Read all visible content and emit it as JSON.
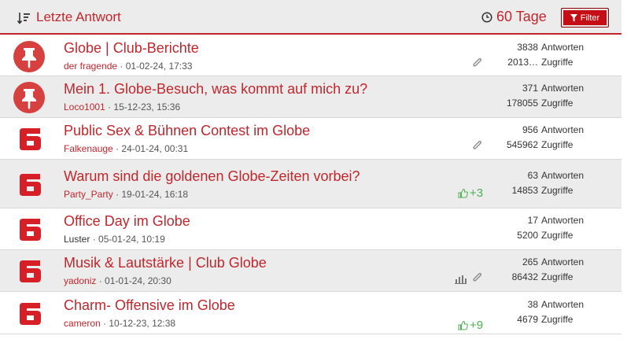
{
  "header": {
    "sort_label": "Letzte Antwort",
    "days_label": "60 Tage",
    "filter_label": "Filter"
  },
  "threads": [
    {
      "title": "Globe | Club-Berichte",
      "author": "der fragende",
      "date": "01-02-24, 17:33",
      "replies": "3838",
      "replies_label": "Antworten",
      "views": "2013…",
      "views_label": "Zugriffe",
      "avatar": "pin-icon",
      "attachment": true,
      "stats": false,
      "likes": ""
    },
    {
      "title": "Mein 1. Globe-Besuch, was kommt auf mich zu?",
      "author": "Loco1001",
      "date": "15-12-23, 15:36",
      "replies": "371",
      "replies_label": "Antworten",
      "views": "178055",
      "views_label": "Zugriffe",
      "avatar": "pin-icon",
      "attachment": false,
      "stats": false,
      "likes": ""
    },
    {
      "title": "Public Sex & Bühnen Contest im Globe",
      "author": "Falkenauge",
      "date": "24-01-24, 00:31",
      "replies": "956",
      "replies_label": "Antworten",
      "views": "545962",
      "views_label": "Zugriffe",
      "avatar": "six-logo",
      "attachment": true,
      "stats": false,
      "likes": ""
    },
    {
      "title": "Warum sind die goldenen Globe-Zeiten vorbei?",
      "author": "Party_Party",
      "date": "19-01-24, 16:18",
      "replies": "63",
      "replies_label": "Antworten",
      "views": "14853",
      "views_label": "Zugriffe",
      "avatar": "six-logo",
      "attachment": false,
      "stats": false,
      "likes": "+3"
    },
    {
      "title": "Office Day im Globe",
      "author": "Luster",
      "date": "05-01-24, 10:19",
      "replies": "17",
      "replies_label": "Antworten",
      "views": "5200",
      "views_label": "Zugriffe",
      "avatar": "six-logo",
      "attachment": false,
      "stats": false,
      "likes": ""
    },
    {
      "title": "Musik & Lautstärke | Club Globe",
      "author": "yadoniz",
      "date": "01-01-24, 20:30",
      "replies": "265",
      "replies_label": "Antworten",
      "views": "86432",
      "views_label": "Zugriffe",
      "avatar": "six-logo",
      "attachment": true,
      "stats": true,
      "likes": ""
    },
    {
      "title": "Charm- Offensive im Globe",
      "author": "cameron",
      "date": "10-12-23, 12:38",
      "replies": "38",
      "replies_label": "Antworten",
      "views": "4679",
      "views_label": "Zugriffe",
      "avatar": "six-logo",
      "attachment": false,
      "stats": false,
      "likes": "+9"
    }
  ],
  "colors": {
    "accent": "#c0272d",
    "like": "#4caf50",
    "row_alt": "#ececec"
  }
}
